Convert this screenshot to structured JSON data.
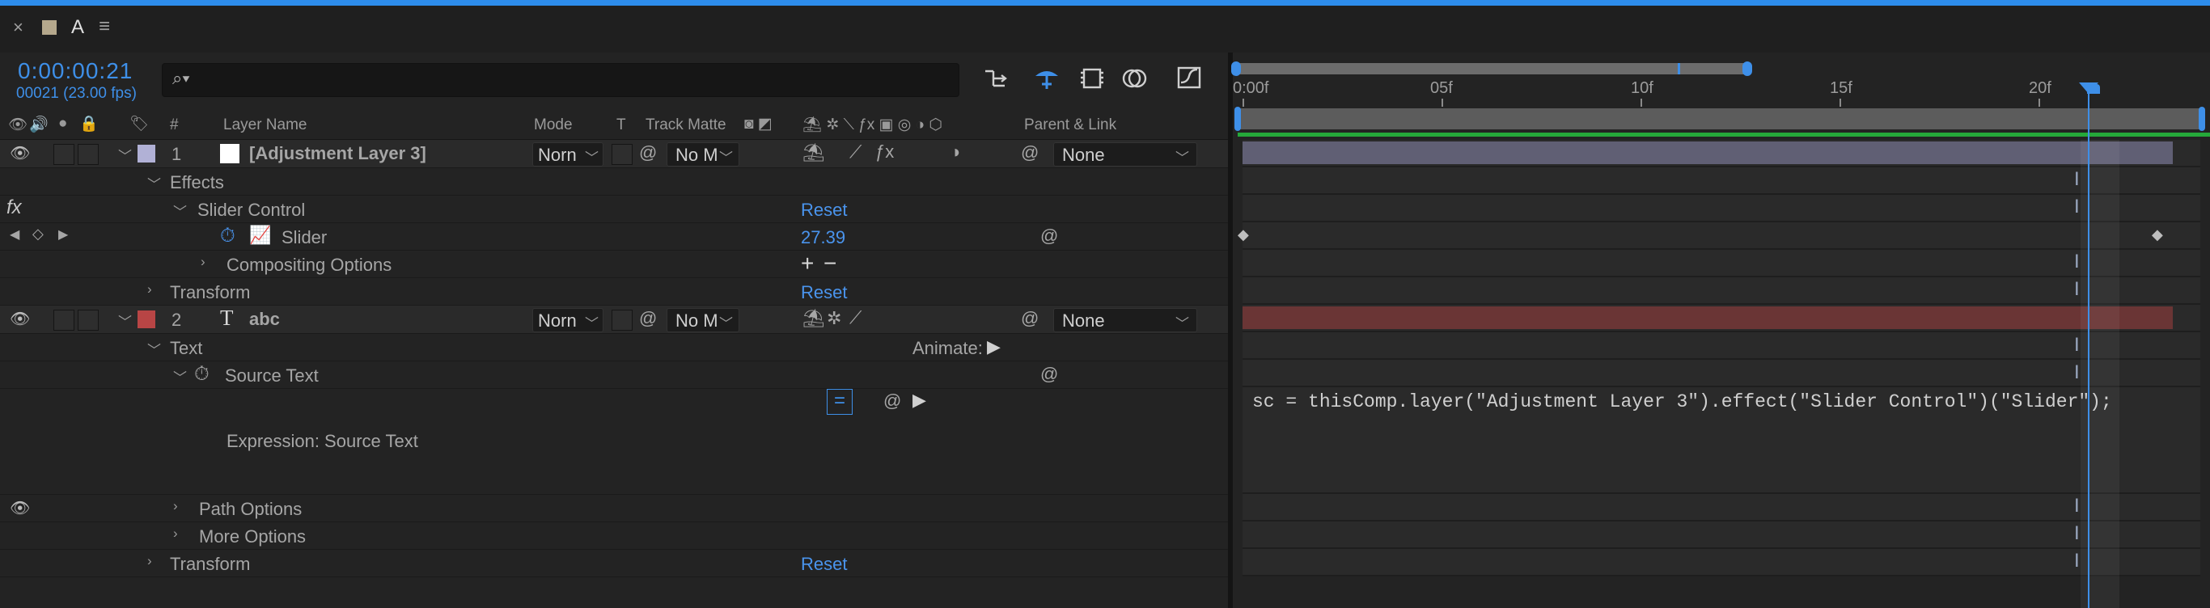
{
  "window": {
    "tabs": [
      {
        "label": "A",
        "icon": "text-tool-icon"
      }
    ]
  },
  "panel": {
    "timecode": "0:00:00:21",
    "frames_info": "00021 (23.00 fps)",
    "search_placeholder": ""
  },
  "columns": {
    "number": "#",
    "layer_name": "Layer Name",
    "mode": "Mode",
    "t": "T",
    "track_matte": "Track Matte",
    "parent_link": "Parent & Link"
  },
  "layers": [
    {
      "index": "1",
      "name": "[Adjustment Layer 3]",
      "mode": "Norn",
      "matte": "No M",
      "parent": "None",
      "label_color": "#b1b1d6"
    },
    {
      "index": "2",
      "name": "abc",
      "mode": "Norn",
      "matte": "No M",
      "parent": "None",
      "label_color": "#b84545"
    }
  ],
  "properties": {
    "effects": "Effects",
    "slider_control": "Slider Control",
    "reset": "Reset",
    "slider": "Slider",
    "slider_value": "27.39",
    "compositing_options": "Compositing Options",
    "transform": "Transform",
    "text": "Text",
    "animate": "Animate:",
    "source_text": "Source Text",
    "expression_label": "Expression: Source Text",
    "path_options": "Path Options",
    "more_options": "More Options",
    "fx_label": "fx"
  },
  "timeline": {
    "ticks": [
      "0:00f",
      "05f",
      "10f",
      "15f",
      "20f"
    ],
    "expression_code": "sc = thisComp.layer(\"Adjustment Layer 3\").effect(\"Slider Control\")(\"Slider\");",
    "current_frame": 21,
    "work_area_end_fraction": 0.985
  },
  "colors": {
    "accent": "#3e8fe8",
    "adjustment_bar": "#605f74",
    "text_bar": "#6a3535",
    "work_area_green": "#25a83a"
  }
}
